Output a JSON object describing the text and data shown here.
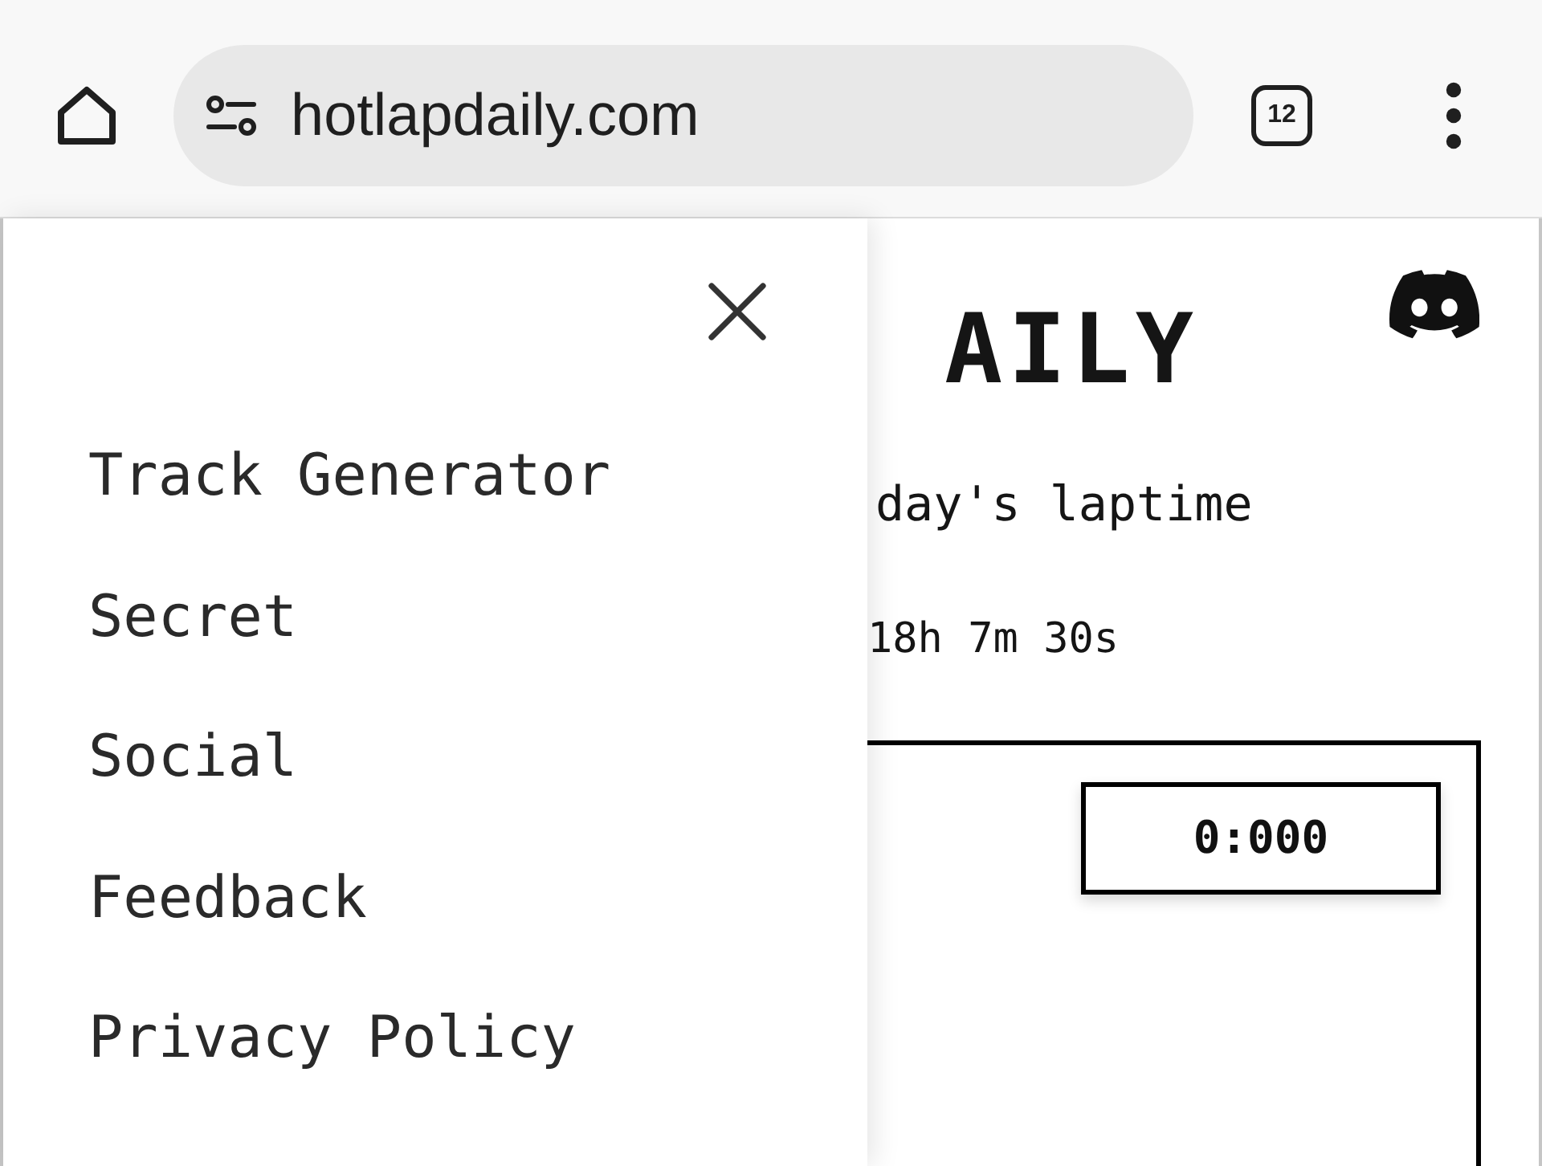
{
  "browser": {
    "url": "hotlapdaily.com",
    "tab_count": "12"
  },
  "side_menu": {
    "items": [
      {
        "label": "Track Generator"
      },
      {
        "label": "Secret"
      },
      {
        "label": "Social"
      },
      {
        "label": "Feedback"
      },
      {
        "label": "Privacy Policy"
      }
    ]
  },
  "page": {
    "title": "AILY",
    "subtitle": "day's laptime",
    "countdown": "18h 7m 30s",
    "timer": "0:000"
  }
}
